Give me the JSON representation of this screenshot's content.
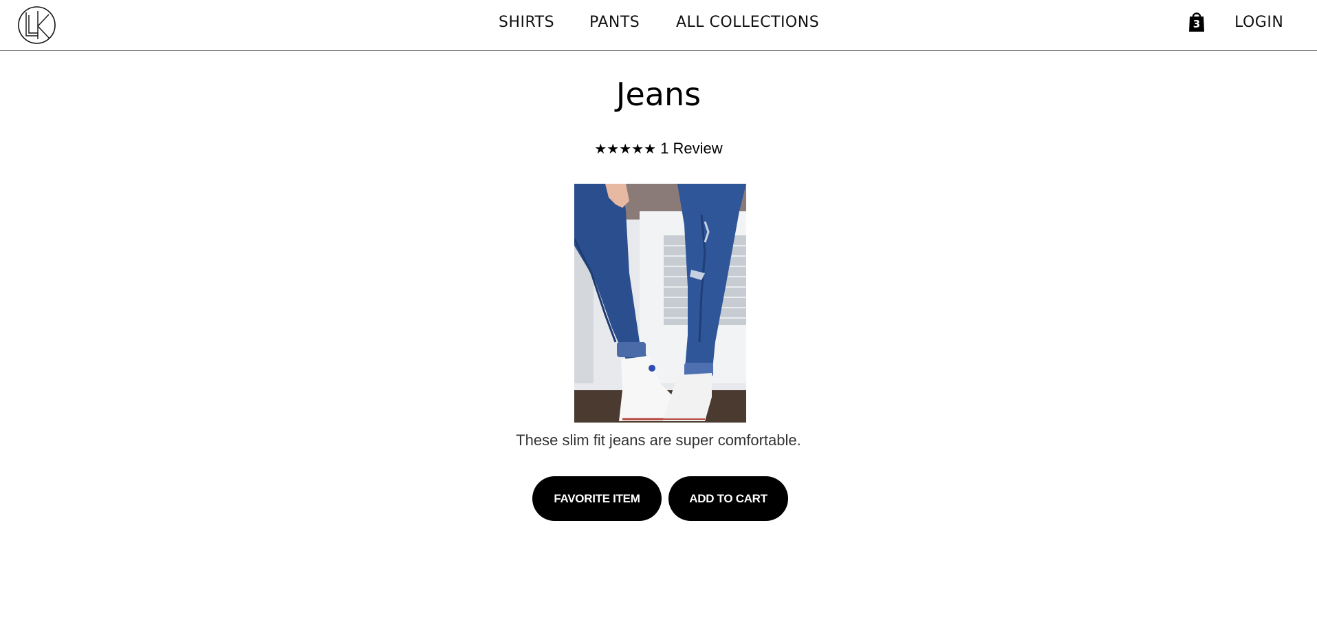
{
  "header": {
    "logo_text": "LK",
    "nav": [
      {
        "label": "SHIRTS"
      },
      {
        "label": "PANTS"
      },
      {
        "label": "ALL COLLECTIONS"
      }
    ],
    "cart_count": "3",
    "login_label": "LOGIN"
  },
  "product": {
    "title": "Jeans",
    "stars": "★★★★★",
    "review_count": "1 Review",
    "rating": 5,
    "description": "These slim fit jeans are super comfortable.",
    "favorite_label": "FAVORITE ITEM",
    "add_to_cart_label": "ADD TO CART"
  },
  "colors": {
    "accent": "#000000",
    "background": "#ffffff",
    "denim": "#2b4f8e"
  }
}
